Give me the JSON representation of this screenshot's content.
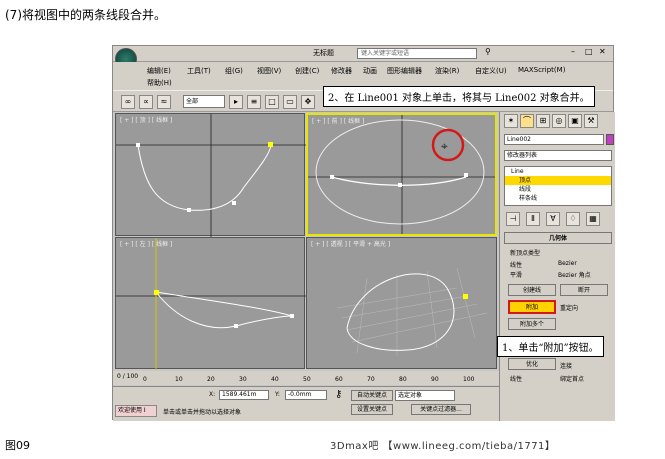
{
  "caption": "(7)将视图中的两条线段合并。",
  "figure_label": "图09",
  "footer": "3Dmax吧 【www.lineeg.com/tieba/1771】",
  "window": {
    "title": "无标题",
    "search_placeholder": "键入关键字或短语"
  },
  "menu": [
    "编辑(E)",
    "工具(T)",
    "组(G)",
    "视图(V)",
    "创建(C)",
    "修改器",
    "动画",
    "图形编辑器",
    "渲染(R)",
    "自定义(U)",
    "MAXScript(M)",
    "帮助(H)"
  ],
  "toolbar": {
    "selection_filter": "全部"
  },
  "viewports": {
    "top": "[ + ] [ 顶 ] [ 线框 ]",
    "front": "[ + ] [ 前 ] [ 线框 ]",
    "left": "[ + ] [ 左 ] [ 线框 ]",
    "persp": "[ + ] [ 透视 ] [ 平滑 + 高光 ]"
  },
  "panel": {
    "object_name": "Line002",
    "modifier_list": "修改器列表",
    "stack": [
      "Line",
      "顶点",
      "线段",
      "样条线"
    ],
    "rollout_title": "几何体",
    "new_vertex_type": "新顶点类型",
    "radio": [
      "线性",
      "Bezier",
      "平滑",
      "Bezier 角点"
    ],
    "create_line": "创建线",
    "break": "断开",
    "attach": "附加",
    "attach_multiple": "附加多个",
    "reorient": "重定向",
    "optimize": "优化",
    "connect": "连接",
    "linear": "线性",
    "bind_first": "绑定首点"
  },
  "tooltip_main": "2、在 Line001 对象上单击，将其与 Line002 对象合并。",
  "tooltip_attach": "1、单击“附加”按钮。",
  "timeline": {
    "frame": "0 / 100",
    "ticks": [
      "0",
      "10",
      "20",
      "30",
      "40",
      "50",
      "60",
      "70",
      "80",
      "90",
      "100"
    ]
  },
  "status": {
    "welcome": "欢迎使用 I",
    "prompt": "单击或单击并拖动以选择对象",
    "x_label": "X:",
    "x_value": "1589.461m",
    "y_label": "Y:",
    "y_value": "-0.0mm",
    "auto_key": "自动关键点",
    "selected": "选定对象",
    "set_key": "设置关键点",
    "key_filter": "关键点过滤器..."
  },
  "colors": {
    "panel_bg": "#d4d0c8",
    "viewport_bg": "#9a9a9a",
    "active_border": "#e6e600",
    "attach_button": "#ffd200",
    "highlight_circle": "#d41818"
  }
}
